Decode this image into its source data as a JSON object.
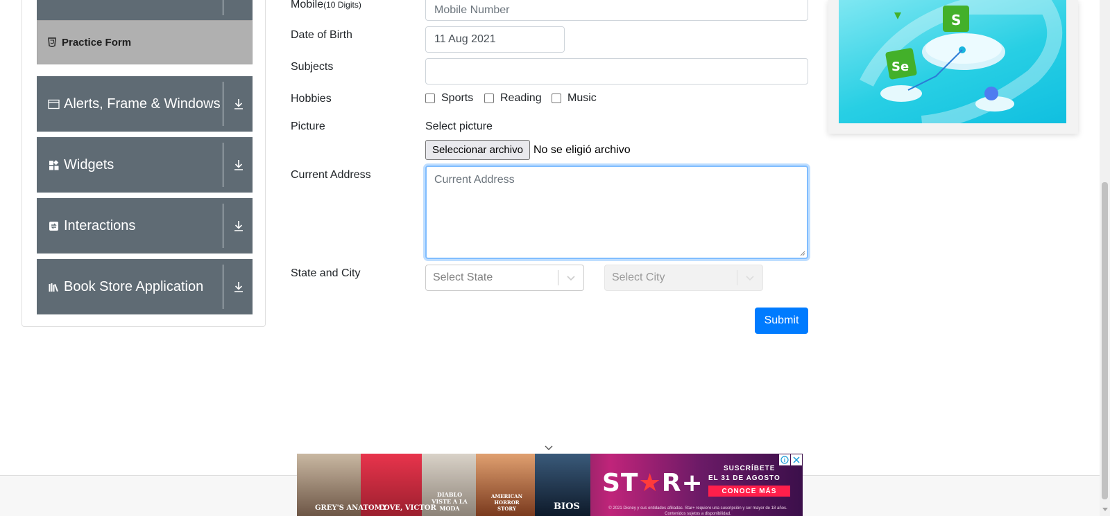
{
  "sidebar": {
    "practice_form": "Practice Form",
    "groups": [
      {
        "label": "Alerts, Frame & Windows",
        "icon": "window-icon"
      },
      {
        "label": "Widgets",
        "icon": "widgets-icon"
      },
      {
        "label": "Interactions",
        "icon": "interactions-icon"
      },
      {
        "label": "Book Store Application",
        "icon": "books-icon"
      }
    ]
  },
  "form": {
    "mobile_label": "Mobile",
    "mobile_hint": "(10 Digits)",
    "mobile_placeholder": "Mobile Number",
    "dob_label": "Date of Birth",
    "dob_value": "11 Aug 2021",
    "subjects_label": "Subjects",
    "hobbies_label": "Hobbies",
    "hobbies": [
      "Sports",
      "Reading",
      "Music"
    ],
    "picture_label": "Picture",
    "picture_caption": "Select picture",
    "file_button": "Seleccionar archivo",
    "file_status": "No se eligió archivo",
    "address_label": "Current Address",
    "address_placeholder": "Current Address",
    "state_city_label": "State and City",
    "state_placeholder": "Select State",
    "city_placeholder": "Select City",
    "submit": "Submit"
  },
  "ad": {
    "titles": [
      "GREY'S ANATOMY",
      "LOVE, VICTOR",
      "DIABLO VISTE A LA MODA",
      "AMERICAN HORROR STORY",
      "BIOS"
    ],
    "brand_prefix": "ST",
    "brand_suffix": "R+",
    "line1": "SUSCRÍBETE",
    "line2": "EL 31 DE AGOSTO",
    "cta": "CONOCE MÁS",
    "legal": "© 2021 Disney y sus entidades afiliadas. Star+ requiere una suscripción y ser mayor de 18 años. Contenidos sujetos a disponibilidad."
  },
  "colors": {
    "sidebar_group": "#5f6b74",
    "practice_active": "#b0b0b0",
    "submit": "#007bff",
    "focus": "#80bdff"
  }
}
